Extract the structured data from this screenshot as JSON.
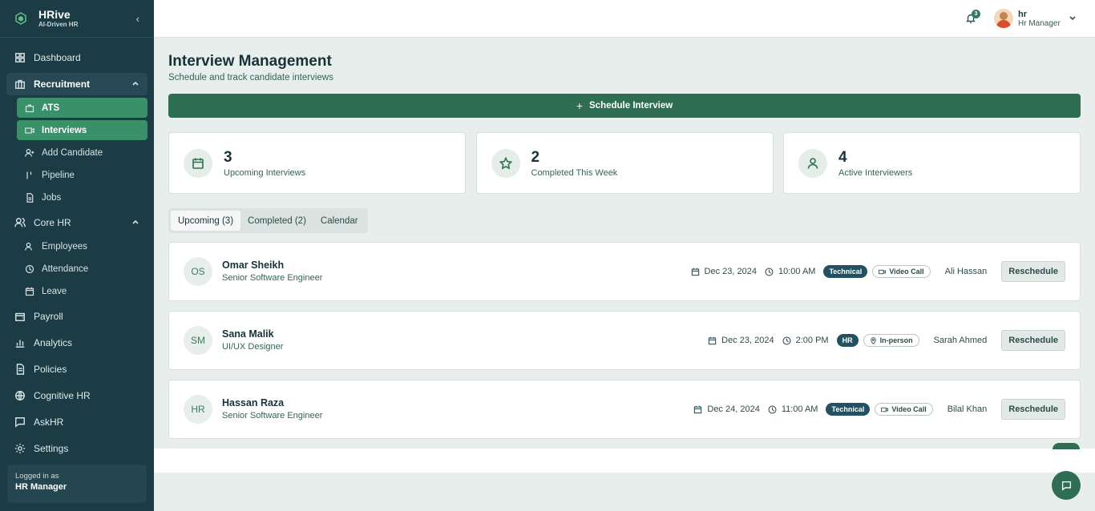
{
  "brand": {
    "name": "HRive",
    "tagline": "AI-Driven HR"
  },
  "sidebar": {
    "items": [
      {
        "label": "Dashboard"
      },
      {
        "label": "Recruitment",
        "children": [
          {
            "label": "ATS"
          },
          {
            "label": "Interviews"
          },
          {
            "label": "Add Candidate"
          },
          {
            "label": "Pipeline"
          },
          {
            "label": "Jobs"
          }
        ]
      },
      {
        "label": "Core HR",
        "children": [
          {
            "label": "Employees"
          },
          {
            "label": "Attendance"
          },
          {
            "label": "Leave"
          }
        ]
      },
      {
        "label": "Payroll"
      },
      {
        "label": "Analytics"
      },
      {
        "label": "Policies"
      },
      {
        "label": "Cognitive HR"
      },
      {
        "label": "AskHR"
      },
      {
        "label": "Settings"
      }
    ],
    "logged_in_label": "Logged in as",
    "logged_in_role": "HR Manager"
  },
  "topbar": {
    "notification_count": "3",
    "user_name": "hr",
    "user_role": "Hr Manager"
  },
  "page": {
    "title": "Interview Management",
    "subtitle": "Schedule and track candidate interviews",
    "schedule_button": "Schedule Interview"
  },
  "stats": [
    {
      "value": "3",
      "label": "Upcoming Interviews",
      "icon": "calendar-icon"
    },
    {
      "value": "2",
      "label": "Completed This Week",
      "icon": "star-icon"
    },
    {
      "value": "4",
      "label": "Active Interviewers",
      "icon": "user-icon"
    }
  ],
  "tabs": [
    {
      "label": "Upcoming (3)"
    },
    {
      "label": "Completed (2)"
    },
    {
      "label": "Calendar"
    }
  ],
  "interviews": [
    {
      "initials": "OS",
      "name": "Omar Sheikh",
      "role": "Senior Software Engineer",
      "date": "Dec 23, 2024",
      "time": "10:00 AM",
      "type": "Technical",
      "mode": "Video Call",
      "interviewer": "Ali Hassan",
      "action": "Reschedule"
    },
    {
      "initials": "SM",
      "name": "Sana Malik",
      "role": "UI/UX Designer",
      "date": "Dec 23, 2024",
      "time": "2:00 PM",
      "type": "HR",
      "mode": "In-person",
      "interviewer": "Sarah Ahmed",
      "action": "Reschedule"
    },
    {
      "initials": "HR",
      "name": "Hassan Raza",
      "role": "Senior Software Engineer",
      "date": "Dec 24, 2024",
      "time": "11:00 AM",
      "type": "Technical",
      "mode": "Video Call",
      "interviewer": "Bilal Khan",
      "action": "Reschedule"
    }
  ],
  "colors": {
    "sidebar": "#1b3b45",
    "accent": "#2f6e53",
    "active_nav": "#3a9068"
  }
}
